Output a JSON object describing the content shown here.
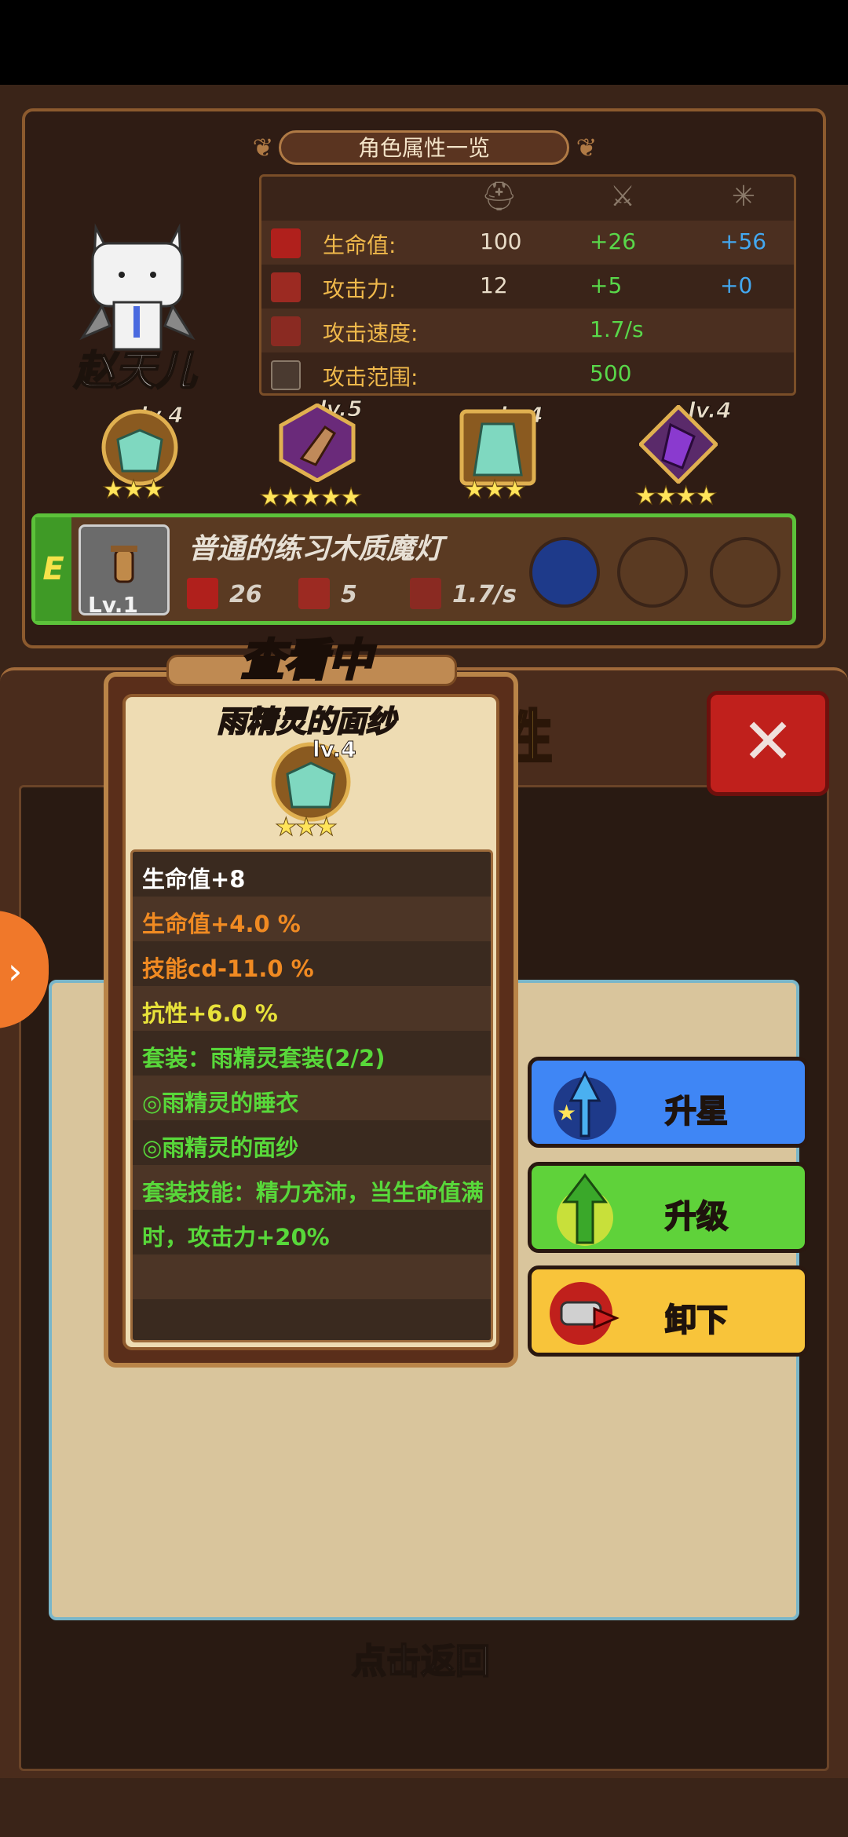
{
  "panel_title": "角色属性一览",
  "character": {
    "name": "赵天儿"
  },
  "attr_columns": [
    "helmet-icon",
    "sword-icon",
    "sparkle-icon"
  ],
  "attributes": [
    {
      "label": "生命值:",
      "base": "100",
      "equip": "+26",
      "set": "+56"
    },
    {
      "label": "攻击力:",
      "base": "12",
      "equip": "+5",
      "set": "+0"
    },
    {
      "label": "攻击速度:",
      "base": "",
      "equip": "1.7/s",
      "set": ""
    },
    {
      "label": "攻击范围:",
      "base": "",
      "equip": "500",
      "set": ""
    }
  ],
  "equipment": [
    {
      "name": "veil",
      "lv": "lv.4",
      "stars": "★★★"
    },
    {
      "name": "boot",
      "lv": "lv.5",
      "stars": "★★★★★"
    },
    {
      "name": "robe",
      "lv": "lv.4",
      "stars": "★★★"
    },
    {
      "name": "cape",
      "lv": "lv.4",
      "stars": "★★★★"
    }
  ],
  "weapon": {
    "grade": "E",
    "name": "普通的练习木质魔灯",
    "lv": "Lv.1",
    "hp": "26",
    "atk": "5",
    "speed": "1.7/s"
  },
  "bg_title": "性",
  "viewing_label": "查看中",
  "item": {
    "name": "雨精灵的面纱",
    "lv": "lv.4",
    "stars": "★★★",
    "stats": [
      {
        "text": "生命值+8",
        "color": "#ffffff"
      },
      {
        "text": "生命值+4.0 %",
        "color": "#f08a22"
      },
      {
        "text": "技能cd-11.0 %",
        "color": "#f08a22"
      },
      {
        "text": "抗性+6.0 %",
        "color": "#e8e23a"
      },
      {
        "text": "套装：雨精灵套装(2/2)",
        "color": "#58d83a"
      },
      {
        "text": "◎雨精灵的睡衣",
        "color": "#58d83a"
      },
      {
        "text": "◎雨精灵的面纱",
        "color": "#58d83a"
      },
      {
        "text": "套装技能：精力充沛，当生命值满",
        "color": "#58d83a"
      },
      {
        "text": "时，攻击力+20%",
        "color": "#58d83a"
      },
      {
        "text": "",
        "color": "#ffffff"
      },
      {
        "text": "",
        "color": "#ffffff"
      }
    ]
  },
  "buttons": {
    "star_up": "升星",
    "level_up": "升级",
    "unequip": "卸下"
  },
  "back_label": "点击返回",
  "close_symbol": "✕"
}
